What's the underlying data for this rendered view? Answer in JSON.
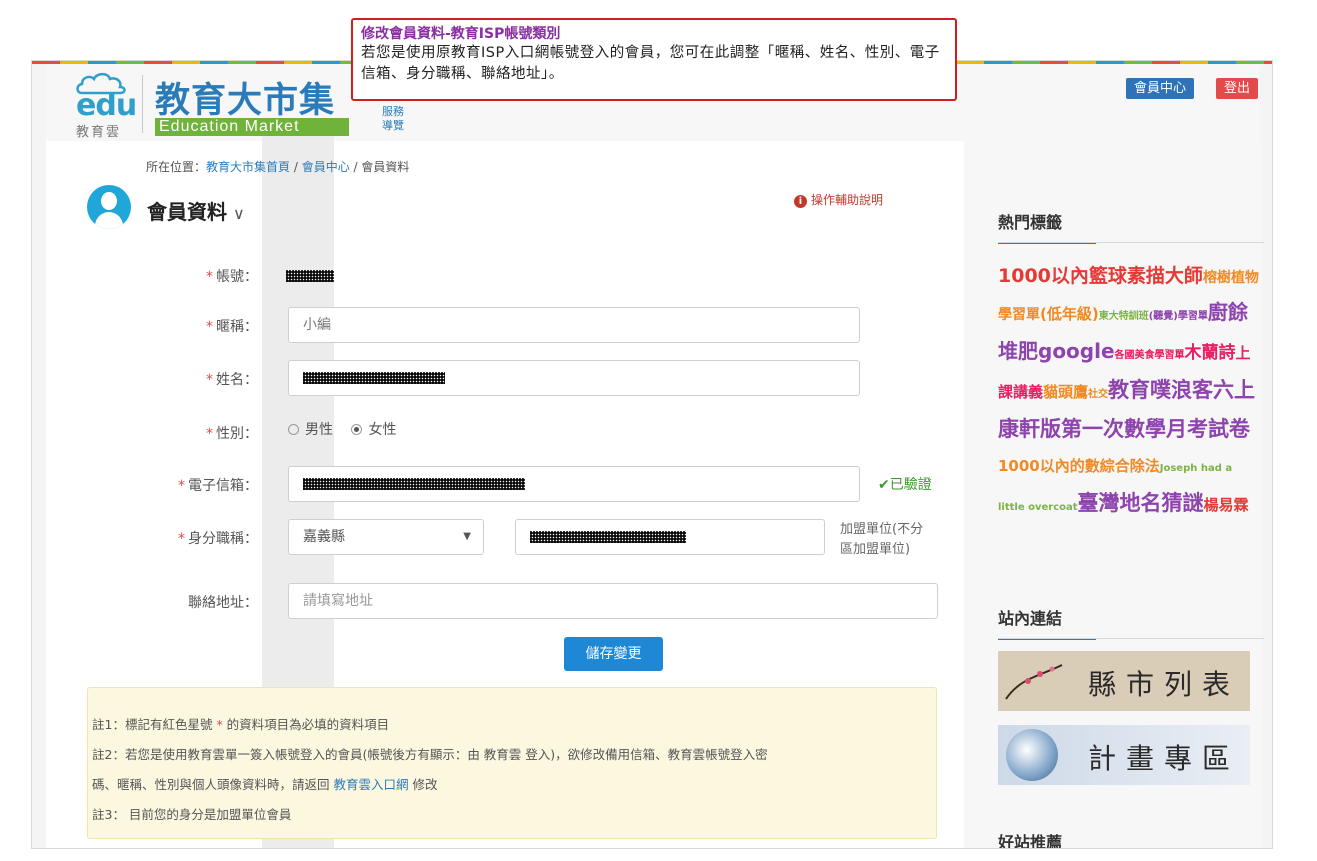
{
  "header": {
    "logo_edu_text": "edu",
    "logo_edu_cn": "教育雲",
    "logo_title": "教育大市集",
    "logo_english": "Education Market",
    "mini_menu": [
      "服務",
      "導覽"
    ],
    "member_center_label": "會員中心",
    "logout_label": "登出"
  },
  "breadcrumb": {
    "prefix": "所在位置：",
    "home": "教育大市集首頁",
    "sep": " / ",
    "member_center": "會員中心",
    "current": "會員資料"
  },
  "page": {
    "title": "會員資料",
    "help_link": "操作輔助說明"
  },
  "form": {
    "account_label": "帳號：",
    "nickname_label": "暱稱：",
    "nickname_value": "小編",
    "name_label": "姓名：",
    "gender_label": "性別：",
    "gender_options": [
      "男性",
      "女性"
    ],
    "gender_selected": "女性",
    "email_label": "電子信箱：",
    "email_verified": "✔已驗證",
    "identity_label": "身分職稱：",
    "county_value": "嘉義縣",
    "unit_note_line1": "加盟單位(不分",
    "unit_note_line2": "區加盟單位)",
    "address_label": "聯絡地址：",
    "address_placeholder": "請填寫地址",
    "required_mark": "*",
    "save_label": "儲存變更"
  },
  "notes": {
    "note1_a": "註1：標記有紅色星號",
    "note1_star": " * ",
    "note1_b": "的資料項目為必填的資料項目",
    "note2_a": "註2：若您是使用教育雲單一簽入帳號登入的會員(帳號後方有顯示：由 教育雲 登入)，欲修改備用信箱、教育雲帳號登入密",
    "note2_b": "碼、暱稱、性別與個人頭像資料時，請返回 ",
    "note2_link": "教育雲入口網",
    "note2_c": " 修改",
    "note3": "註3： 目前您的身分是加盟單位會員"
  },
  "sidebar": {
    "hot_tags_title": "熱門標籤",
    "tags": [
      {
        "text": "1000以內",
        "color": "#e53935",
        "size": 19
      },
      {
        "text": "籃球",
        "color": "#e53935",
        "size": 19
      },
      {
        "text": "素描",
        "color": "#e53935",
        "size": 19
      },
      {
        "text": "大師",
        "color": "#e53935",
        "size": 19
      },
      {
        "text": "榕樹",
        "color": "#f08a24",
        "size": 14
      },
      {
        "text": "植物學習單",
        "color": "#f08a24",
        "size": 14
      },
      {
        "text": "(低年級)",
        "color": "#f08a24",
        "size": 15
      },
      {
        "text": "東大特訓班",
        "color": "#7cb342",
        "size": 10
      },
      {
        "text": "(聽覺)學習單",
        "color": "#8e44ad",
        "size": 10
      },
      {
        "text": "廚餘堆肥",
        "color": "#8e44ad",
        "size": 20
      },
      {
        "text": "google",
        "color": "#8e44ad",
        "size": 20
      },
      {
        "text": "各國美食學習單",
        "color": "#e91e63",
        "size": 10
      },
      {
        "text": "木蘭詩",
        "color": "#e91e63",
        "size": 17
      },
      {
        "text": "上課講義",
        "color": "#e91e63",
        "size": 15
      },
      {
        "text": "貓頭鷹",
        "color": "#f08a24",
        "size": 15
      },
      {
        "text": "社交",
        "color": "#f08a24",
        "size": 10
      },
      {
        "text": "教育噗浪客",
        "color": "#8e44ad",
        "size": 21
      },
      {
        "text": "六上康軒版第一次數學月考試卷",
        "color": "#8e44ad",
        "size": 21
      },
      {
        "text": "1000以內的數綜合除法",
        "color": "#f08a24",
        "size": 15
      },
      {
        "text": "Joseph had a little overcoat",
        "color": "#7cb342",
        "size": 10
      },
      {
        "text": "臺灣地名猜謎",
        "color": "#8e44ad",
        "size": 21
      },
      {
        "text": "楊易霖",
        "color": "#e53935",
        "size": 15
      }
    ],
    "links_title": "站內連結",
    "banner_county": "縣市列表",
    "banner_plan": "計畫專區",
    "good_sites_title": "好站推薦"
  },
  "tooltip": {
    "title": "修改會員資料-教育ISP帳號類別",
    "body": "若您是使用原教育ISP入口網帳號登入的會員，您可在此調整「暱稱、姓名、性別、電子信箱、身分職稱、聯絡地址」。"
  }
}
